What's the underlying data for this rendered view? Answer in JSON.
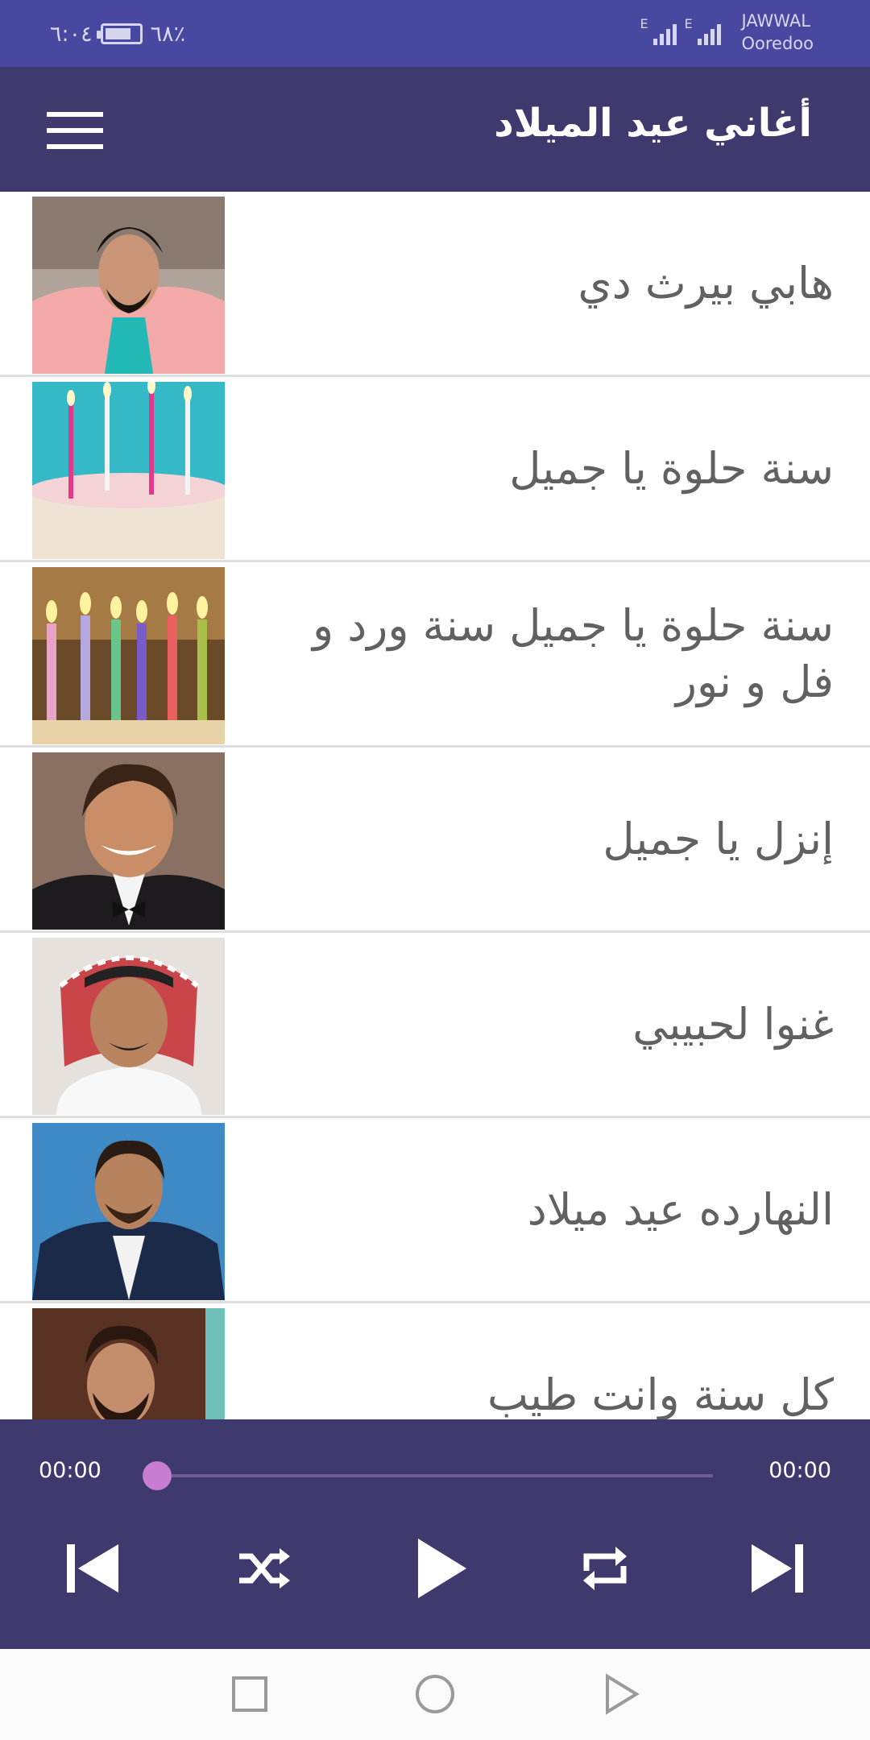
{
  "status_bar": {
    "time": "٦:٠٤",
    "battery_percent": "٦٨٪",
    "carrier_1": "JAWWAL",
    "carrier_2": "Ooredoo",
    "network_type": "E"
  },
  "app_bar": {
    "title": "أغاني عيد الميلاد",
    "menu_icon": "hamburger-menu-icon"
  },
  "songs": [
    {
      "title": "هابي بيرث دي",
      "thumb": "portrait-man-pink-jacket"
    },
    {
      "title": "سنة حلوة يا جميل",
      "thumb": "birthday-cake-candles"
    },
    {
      "title": "سنة حلوة يا جميل سنة ورد و فل و نور",
      "thumb": "colored-candles"
    },
    {
      "title": "إنزل يا جميل",
      "thumb": "portrait-man-bowtie"
    },
    {
      "title": "غنوا لحبيبي",
      "thumb": "portrait-man-keffiyeh"
    },
    {
      "title": "النهارده عيد ميلاد",
      "thumb": "portrait-man-navy-shirt"
    },
    {
      "title": "كل سنة وانت طيب",
      "thumb": "portrait-man-beard"
    }
  ],
  "player": {
    "elapsed": "00:00",
    "duration": "00:00",
    "progress": 0,
    "controls": [
      "previous-icon",
      "shuffle-icon",
      "play-icon",
      "repeat-icon",
      "next-icon"
    ]
  },
  "colors": {
    "status_bar": "#4848a1",
    "app_bar": "#3e3a6e",
    "seek_thumb": "#c77dd1",
    "title_text": "#616161"
  },
  "nav_bar": {
    "buttons": [
      "recents-square-icon",
      "home-circle-icon",
      "back-triangle-icon"
    ]
  }
}
